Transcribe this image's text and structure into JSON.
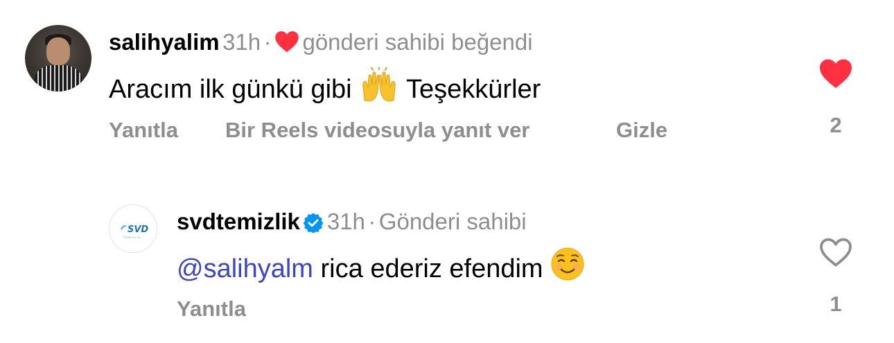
{
  "comments": [
    {
      "username": "salihyalim",
      "time": "31h",
      "separator": "·",
      "liked_by_author_text": "gönderi sahibi beğendi",
      "body_text_1": "Aracım ilk günkü gibi",
      "body_text_2": "Teşekkürler",
      "actions": {
        "reply": "Yanıtla",
        "reels_reply": "Bir Reels videosuyla yanıt ver",
        "hide": "Gizle"
      },
      "like_count": "2",
      "liked": true,
      "like_color": "#ff3040"
    },
    {
      "username": "svdtemizlik",
      "verified": true,
      "time": "31h",
      "separator": "·",
      "author_badge": "Gönderi sahibi",
      "mention": "@salihyalm",
      "body_text": "rica ederiz efendim",
      "actions": {
        "reply": "Yanıtla"
      },
      "like_count": "1",
      "liked": false,
      "avatar_logo_text": "SVD",
      "avatar_logo_sub": "TEMİZLİK"
    }
  ],
  "colors": {
    "meta_gray": "#8e8e8e",
    "mention_blue": "#3d46c2",
    "verified_blue": "#0095f6"
  }
}
